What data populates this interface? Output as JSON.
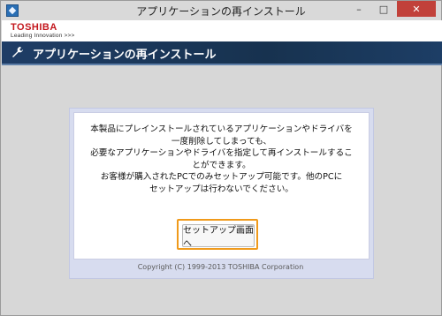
{
  "window": {
    "title": "アプリケーションの再インストール",
    "minimize": "–",
    "maximize": "□",
    "close": "✕"
  },
  "brand": {
    "logo": "TOSHIBA",
    "tagline": "Leading Innovation >>>"
  },
  "header": {
    "icon": "wrench-icon",
    "title": "アプリケーションの再インストール"
  },
  "main": {
    "message": "本製品にプレインストールされているアプリケーションやドライバを\n一度削除してしまっても、\n必要なアプリケーションやドライバを指定して再インストールするこ\nとができます。\nお客様が購入されたPCでのみセットアップ可能です。他のPCに\nセットアップは行わないでください。",
    "setup_button": "セットアップ画面へ",
    "copyright": "Copyright (C) 1999-2013 TOSHIBA Corporation"
  },
  "colors": {
    "header_bg": "#1f3d66",
    "button_highlight": "#f09a1b",
    "logo_red": "#c3161c",
    "panel_border": "#d7dcef"
  }
}
